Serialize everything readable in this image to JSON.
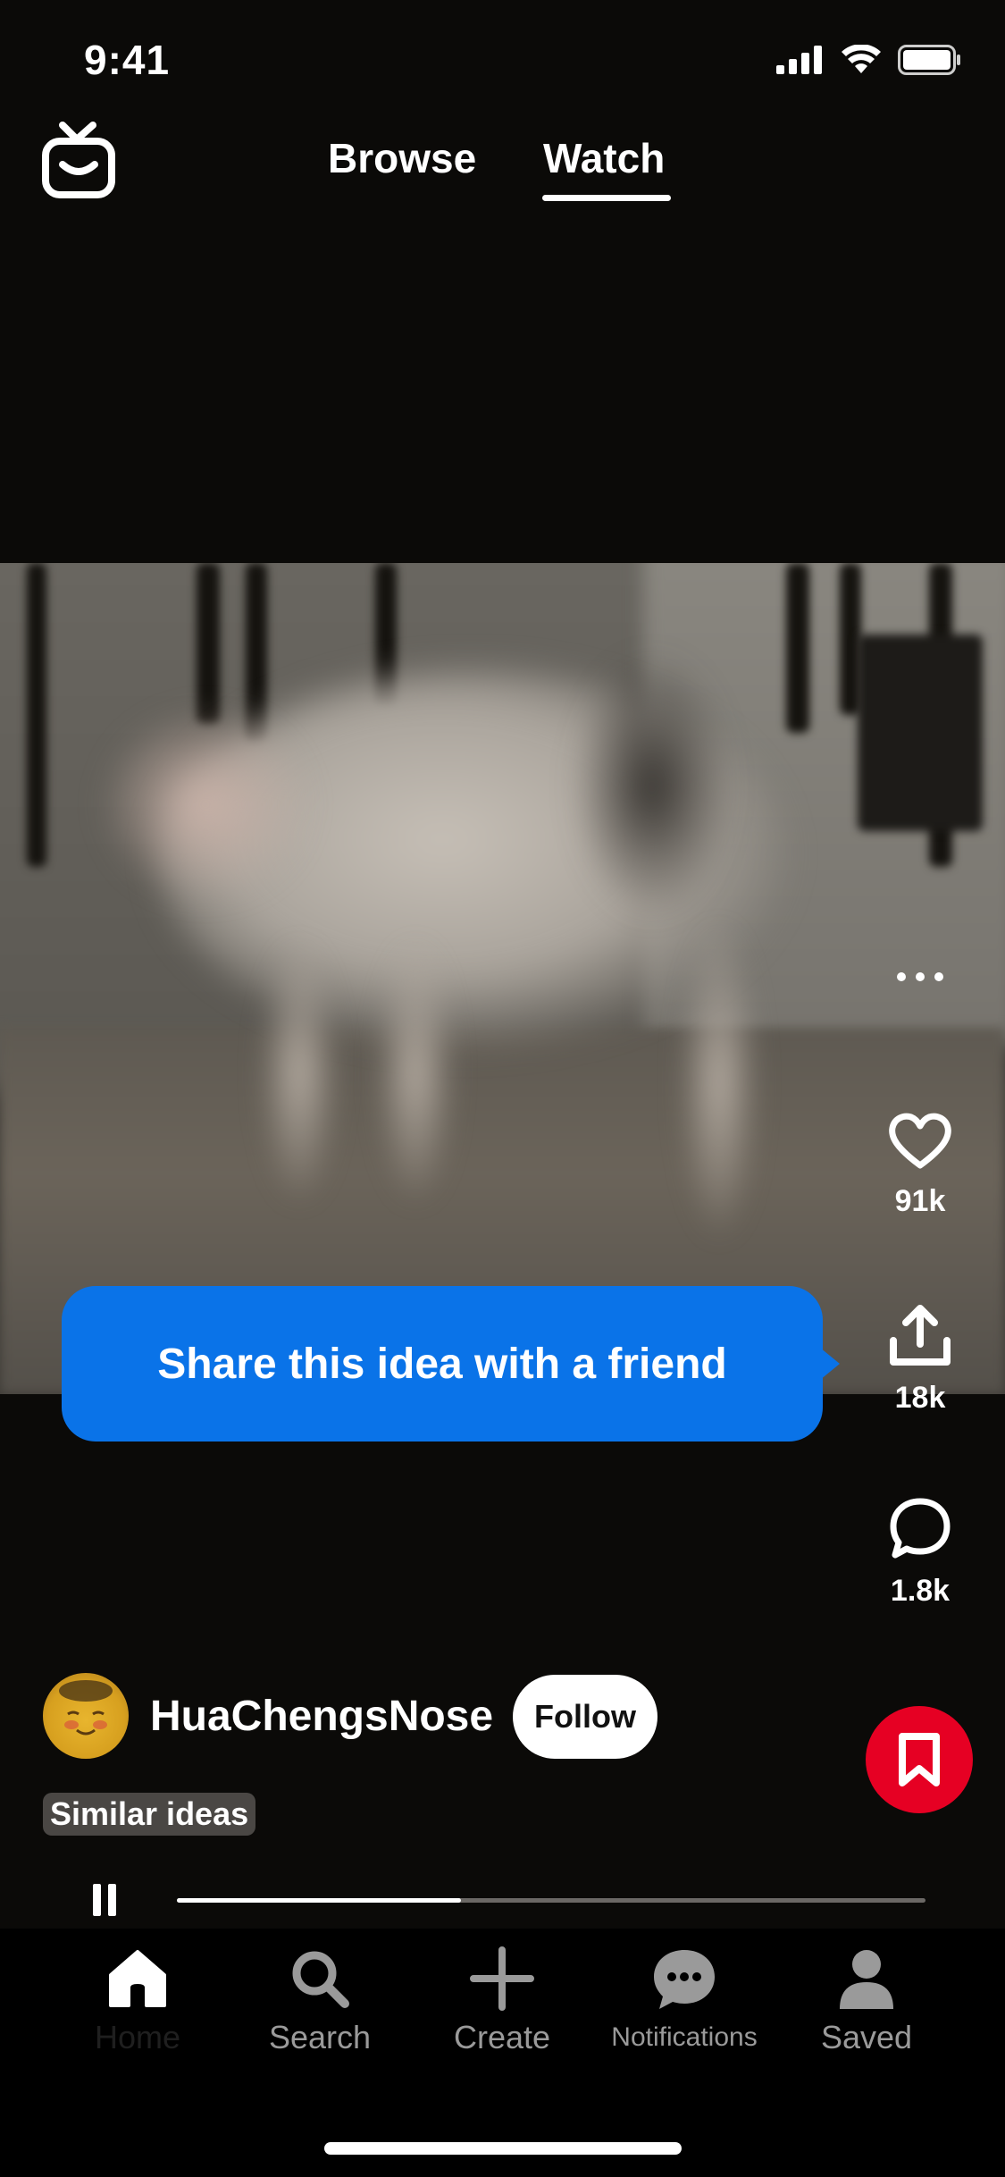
{
  "status_bar": {
    "time": "9:41"
  },
  "header": {
    "tabs": [
      {
        "label": "Browse",
        "active": false
      },
      {
        "label": "Watch",
        "active": true
      }
    ]
  },
  "actions": {
    "like_count": "91k",
    "share_count": "18k",
    "comment_count": "1.8k"
  },
  "tooltip": {
    "text": "Share this idea with a friend"
  },
  "creator": {
    "name": "HuaChengsNose",
    "follow_label": "Follow"
  },
  "similar": {
    "label": "Similar ideas"
  },
  "playback": {
    "progress": 0.38
  },
  "bottom_nav": {
    "items": [
      {
        "label": "Home",
        "icon": "home-icon",
        "active": true
      },
      {
        "label": "Search",
        "icon": "search-icon",
        "active": false
      },
      {
        "label": "Create",
        "icon": "plus-icon",
        "active": false
      },
      {
        "label": "Notifications",
        "icon": "chat-bubble-icon",
        "active": false
      },
      {
        "label": "Saved",
        "icon": "person-icon",
        "active": false
      }
    ]
  },
  "colors": {
    "accent_blue": "#0a73e8",
    "save_red": "#e60023"
  }
}
